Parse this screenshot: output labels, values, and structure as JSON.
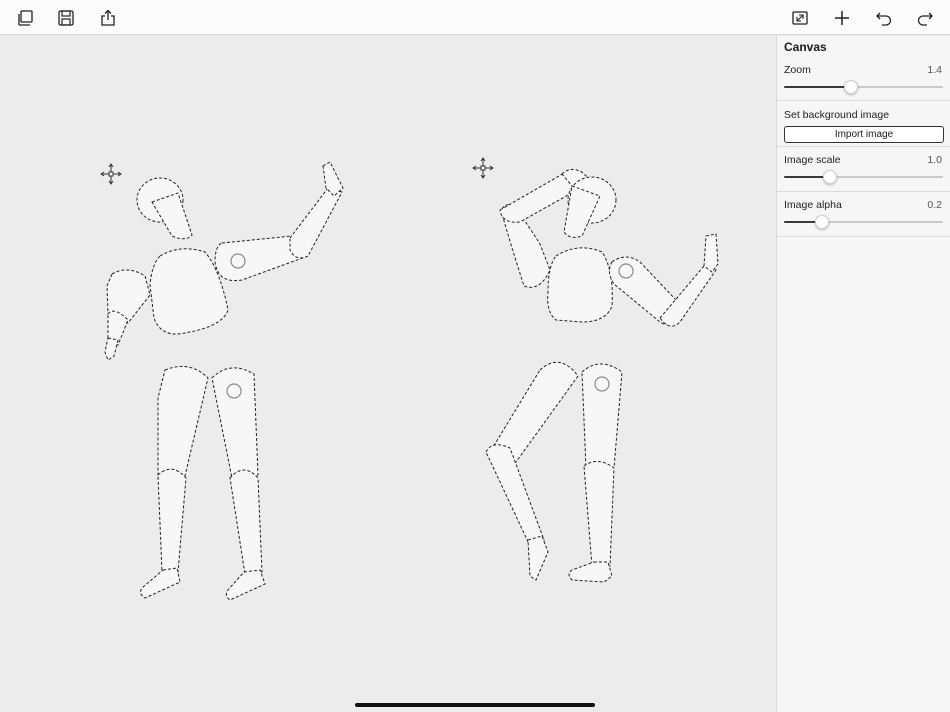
{
  "toolbar": {
    "left_icons": [
      "duplicate-icon",
      "save-icon",
      "share-icon"
    ],
    "right_icons": [
      "fit-screen-icon",
      "add-icon",
      "undo-icon",
      "redo-icon"
    ]
  },
  "panel": {
    "title": "Canvas",
    "zoom": {
      "label": "Zoom",
      "value": "1.4",
      "fraction": 0.42
    },
    "background": {
      "label": "Set background image",
      "button": "Import image"
    },
    "image_scale": {
      "label": "Image scale",
      "value": "1.0",
      "fraction": 0.29
    },
    "image_alpha": {
      "label": "Image alpha",
      "value": "0.2",
      "fraction": 0.24
    }
  },
  "canvas": {
    "figures": [
      "figure-left",
      "figure-right"
    ],
    "stroke_color": "#222222",
    "part_fill": "#f7f7f7"
  }
}
